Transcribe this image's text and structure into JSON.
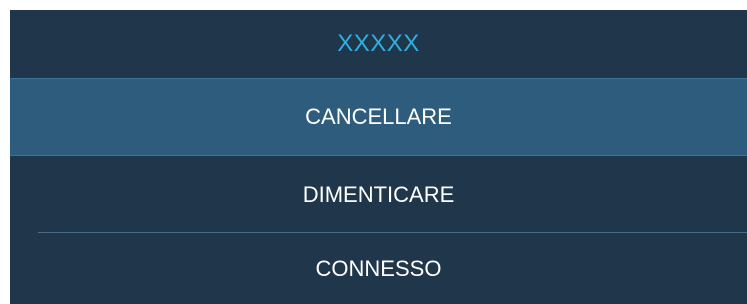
{
  "menu": {
    "title": "XXXXX",
    "items": [
      {
        "label": "CANCELLARE",
        "selected": true
      },
      {
        "label": "DIMENTICARE",
        "selected": false
      },
      {
        "label": "CONNESSO",
        "selected": false
      }
    ]
  },
  "colors": {
    "panel_background": "#1f364b",
    "selected_background": "#2e5c7c",
    "title_text": "#2fb0e3",
    "item_text": "#ffffff"
  }
}
